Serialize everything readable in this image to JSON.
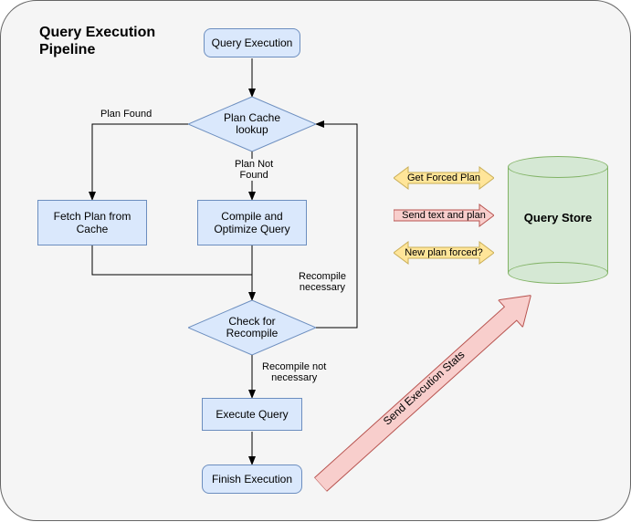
{
  "title": "Query Execution\nPipeline",
  "nodes": {
    "start": "Query Execution",
    "planCache": "Plan Cache\nlookup",
    "fetchCache": "Fetch Plan from\nCache",
    "compile": "Compile and\nOptimize Query",
    "recompile": "Check for\nRecompile",
    "execute": "Execute Query",
    "finish": "Finish Execution",
    "store": "Query Store"
  },
  "edges": {
    "planFound": "Plan Found",
    "planNotFound": "Plan Not\nFound",
    "recompileNecessary": "Recompile\nnecessary",
    "recompileNotNecessary": "Recompile not\nnecessary"
  },
  "arrows": {
    "getForced": "Get Forced Plan",
    "sendText": "Send text and plan",
    "newPlan": "New plan forced?",
    "sendStats": "Send Execution Stats"
  }
}
